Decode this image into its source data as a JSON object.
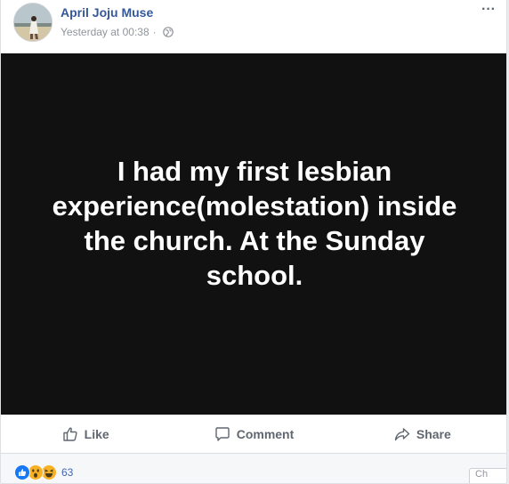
{
  "post": {
    "author": "April Joju Muse",
    "timestamp": "Yesterday at 00:38",
    "separator": "·",
    "privacy_icon": "globe-icon",
    "more_label": "···",
    "image_text": "I had my first lesbian experience(molestation) inside the church. At the Sunday school.",
    "image_background": "#111111"
  },
  "actions": {
    "like_label": "Like",
    "comment_label": "Comment",
    "share_label": "Share"
  },
  "reactions": {
    "types": [
      "like-icon",
      "wow-icon",
      "haha-icon"
    ],
    "count": "63"
  },
  "chat": {
    "label": "Ch"
  },
  "colors": {
    "link": "#365899",
    "muted": "#90949c",
    "action": "#606770",
    "like_blue": "#1877f2",
    "emoji_yellow": "#f7b125"
  }
}
